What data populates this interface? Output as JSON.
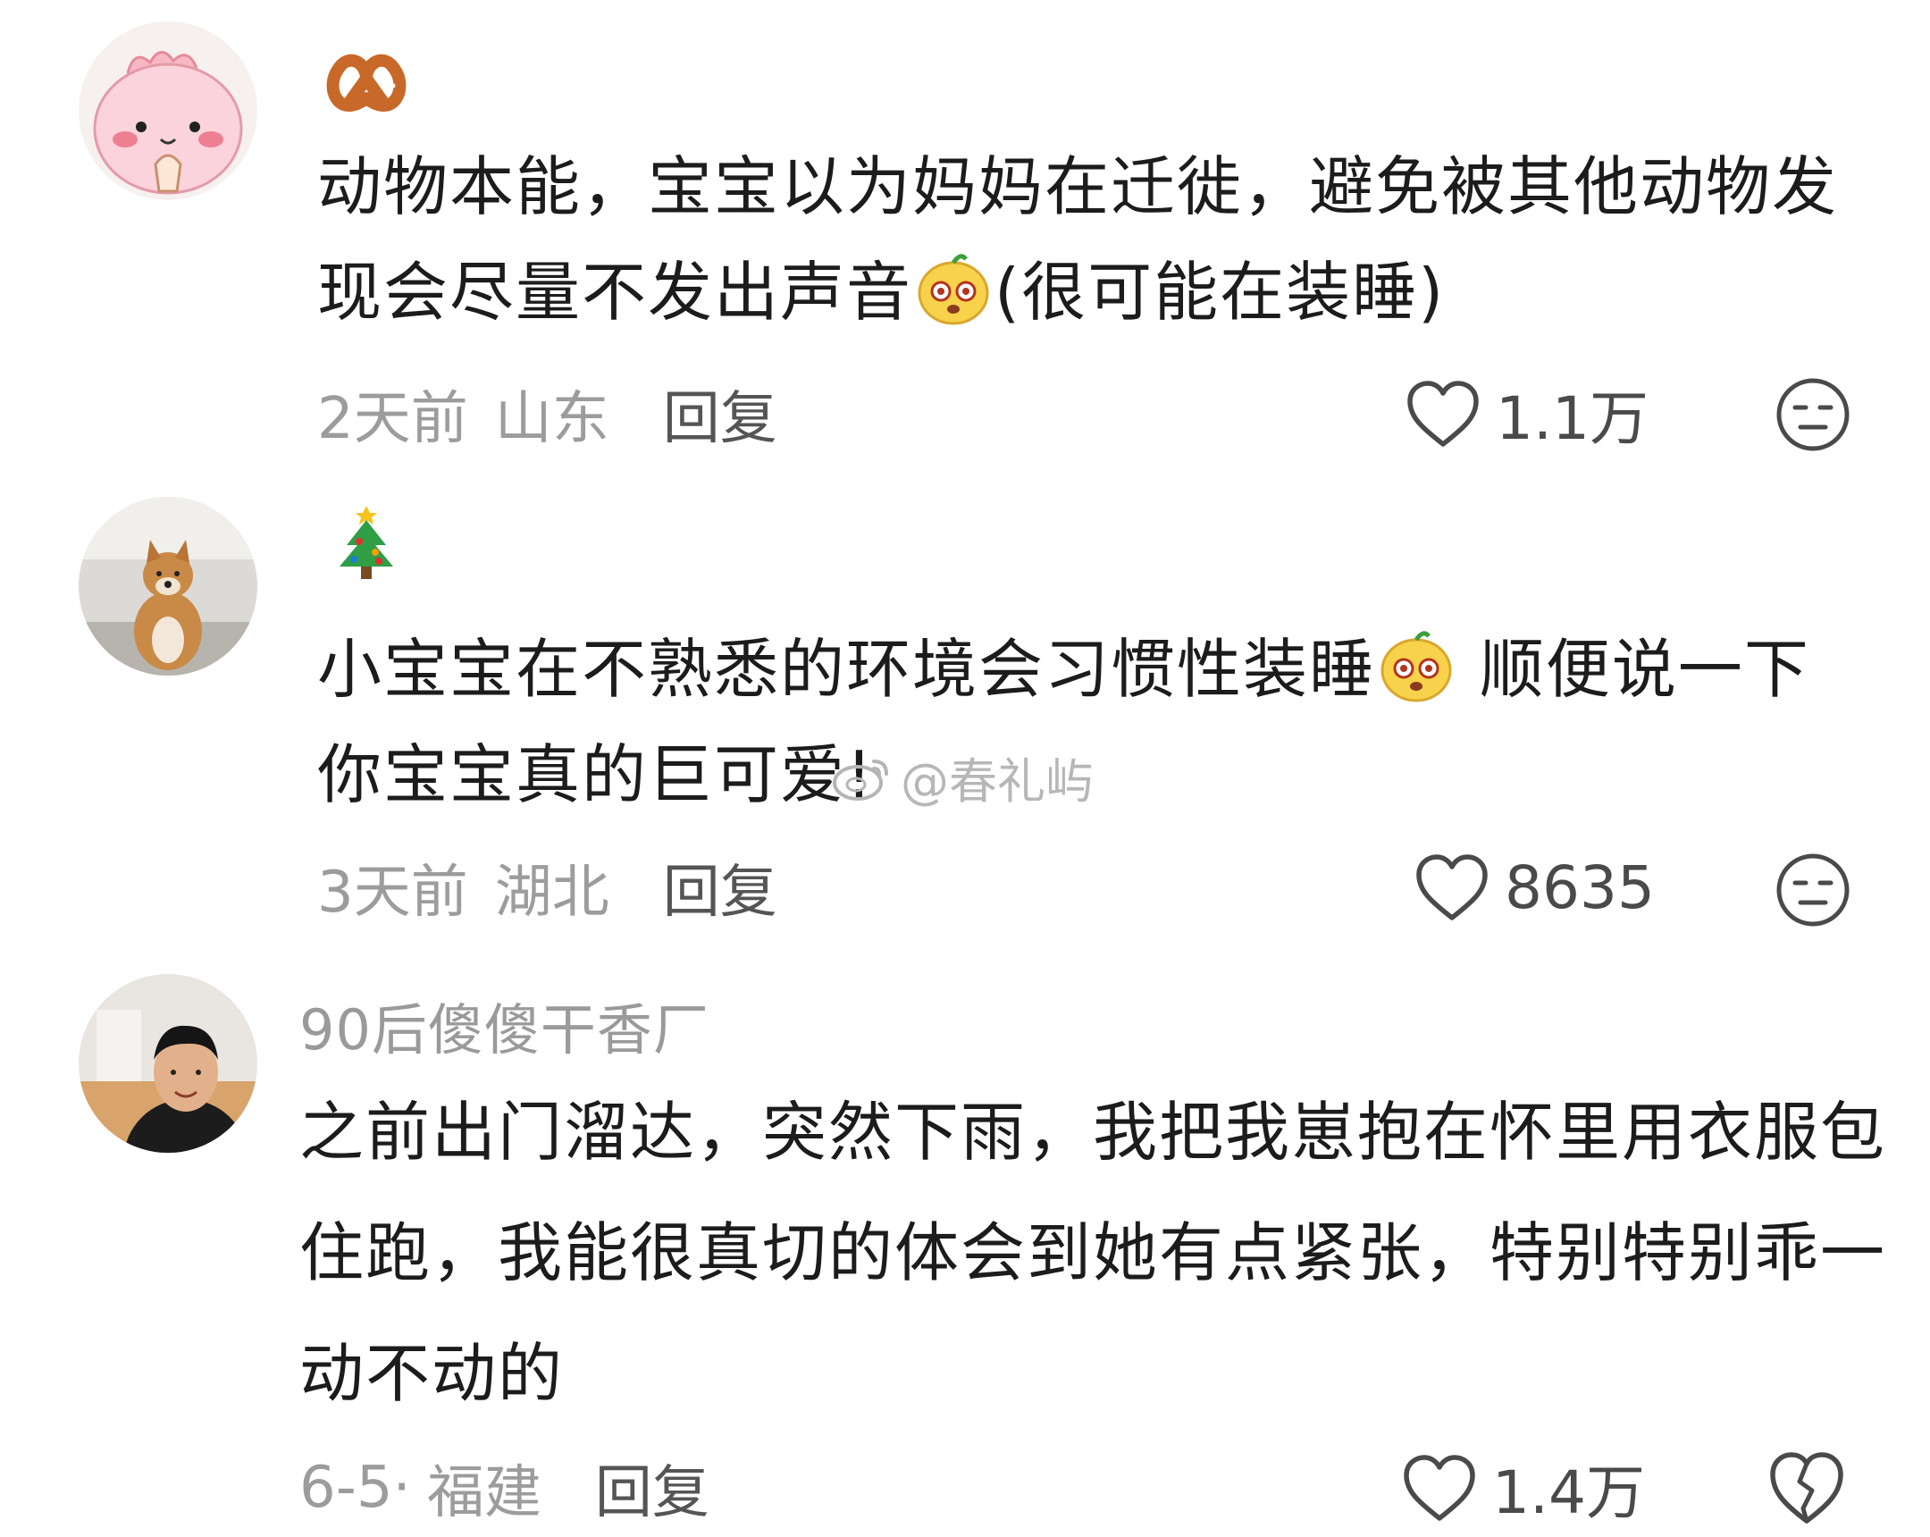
{
  "comments": [
    {
      "username": "",
      "name_emoji": "pretzel-emoji",
      "text_before_emoji": "动物本能，宝宝以为妈妈在迁徙，避免被其他动物发现会尽量不发出声音",
      "text_after_emoji": "(很可能在装睡)",
      "time": "2天前",
      "location": "山东",
      "reply_label": "回复",
      "likes": "1.1万",
      "reaction_icon": "neutral-face-icon"
    },
    {
      "username": "",
      "name_emoji": "christmas-tree-emoji",
      "text_before_emoji": "小宝宝在不熟悉的环境会习惯性装睡",
      "text_after_emoji": "顺便说一下你宝宝真的巨可爱!",
      "time": "3天前",
      "location": "湖北",
      "reply_label": "回复",
      "likes": "8635",
      "reaction_icon": "neutral-face-icon"
    },
    {
      "username": "90后傻傻干香厂",
      "text": "之前出门溜达，突然下雨，我把我崽抱在怀里用衣服包住跑，我能很真切的体会到她有点紧张，特别特别乖一动不动的",
      "time": "6-5·",
      "location": "福建",
      "reply_label": "回复",
      "likes": "1.4万",
      "reaction_icon": "broken-heart-icon"
    }
  ],
  "watermark": {
    "text": "@春礼屿"
  },
  "colors": {
    "text": "#1c1c1c",
    "meta": "#9c9c9c",
    "reply": "#555555",
    "icon": "#4a4a4a"
  }
}
